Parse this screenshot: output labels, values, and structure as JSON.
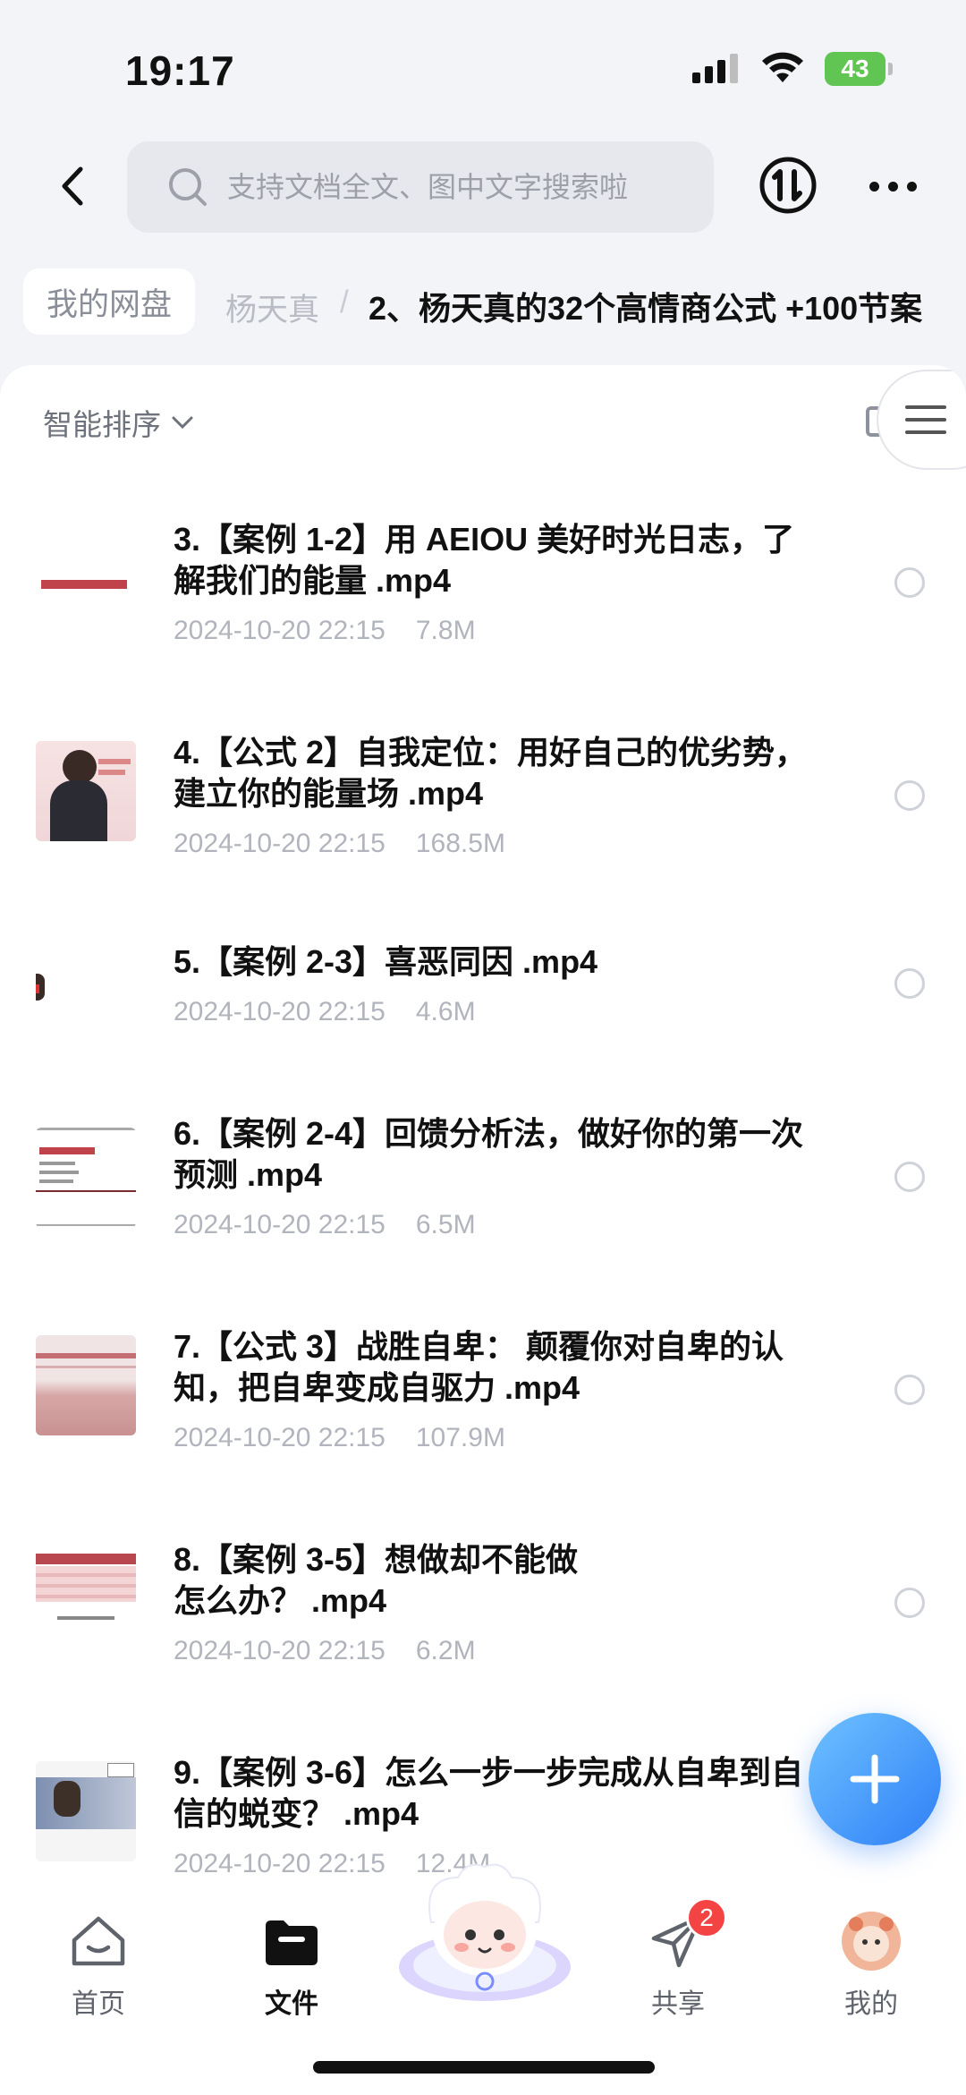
{
  "status": {
    "time": "19:17",
    "battery": "43"
  },
  "search": {
    "placeholder": "支持文档全文、图中文字搜索啦"
  },
  "breadcrumb": {
    "root": "我的网盘",
    "middle": "杨天真",
    "separator": "/",
    "current": "2、杨天真的32个高情商公式 +100节案"
  },
  "sort": {
    "label": "智能排序"
  },
  "files": [
    {
      "title": "3.【案例 1-2】用 AEIOU 美好时光日志，了解我们的能量 .mp4",
      "date": "2024-10-20 22:15",
      "size": "7.8M"
    },
    {
      "title": "4.【公式 2】自我定位：用好自己的优劣势，建立你的能量场 .mp4",
      "date": "2024-10-20 22:15",
      "size": "168.5M"
    },
    {
      "title": "5.【案例 2-3】喜恶同因 .mp4",
      "date": "2024-10-20 22:15",
      "size": "4.6M"
    },
    {
      "title": "6.【案例 2-4】回馈分析法，做好你的第一次预测 .mp4",
      "date": "2024-10-20 22:15",
      "size": "6.5M"
    },
    {
      "title": "7.【公式 3】战胜自卑： 颠覆你对自卑的认知，把自卑变成自驱力 .mp4",
      "date": "2024-10-20 22:15",
      "size": "107.9M"
    },
    {
      "title": "8.【案例 3-5】想做却不能做\n怎么办？ .mp4",
      "date": "2024-10-20 22:15",
      "size": "6.2M"
    },
    {
      "title": "9.【案例 3-6】怎么一步一步完成从自卑到自信的蜕变？ .mp4",
      "date": "2024-10-20 22:15",
      "size": "12.4M"
    }
  ],
  "nav": {
    "home": "首页",
    "files": "文件",
    "share": "共享",
    "share_badge": "2",
    "mine": "我的"
  },
  "colors": {
    "accent": "#2f7ff7",
    "badge": "#f44343",
    "battery": "#61c554"
  }
}
